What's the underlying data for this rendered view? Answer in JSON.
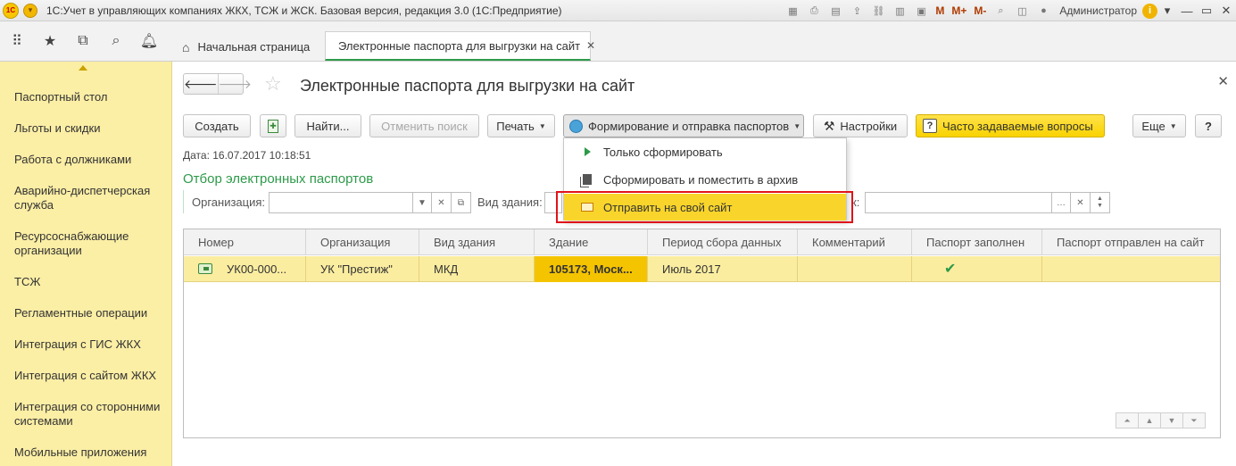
{
  "window": {
    "title": "1С:Учет в управляющих компаниях ЖКХ, ТСЖ и ЖСК. Базовая версия, редакция 3.0  (1С:Предприятие)",
    "user": "Администратор",
    "logo_text": "1С"
  },
  "tabs": [
    {
      "label": "Начальная страница"
    },
    {
      "label": "Электронные паспорта для выгрузки на сайт"
    }
  ],
  "sidebar": {
    "items": [
      {
        "label": "Паспортный стол"
      },
      {
        "label": "Льготы и скидки"
      },
      {
        "label": "Работа с должниками"
      },
      {
        "label": "Аварийно-диспетчерская служба"
      },
      {
        "label": "Ресурсоснабжающие организации"
      },
      {
        "label": "ТСЖ"
      },
      {
        "label": "Регламентные операции"
      },
      {
        "label": "Интеграция с ГИС ЖКХ"
      },
      {
        "label": "Интеграция с сайтом ЖКХ"
      },
      {
        "label": "Интеграция со сторонними системами"
      },
      {
        "label": "Мобильные приложения"
      }
    ]
  },
  "page": {
    "title": "Электронные паспорта для выгрузки на сайт"
  },
  "toolbar": {
    "create": "Создать",
    "find": "Найти...",
    "cancel_search": "Отменить поиск",
    "print": "Печать",
    "form_send": "Формирование и отправка паспортов",
    "settings": "Настройки",
    "faq": "Часто задаваемые вопросы",
    "more": "Еще",
    "help": "?"
  },
  "info": {
    "date_line": "Дата: 16.07.2017 10:18:51"
  },
  "filter": {
    "title": "Отбор электронных паспортов",
    "org_label": "Организация:",
    "building_type_label": "Вид здания:",
    "hidden_label_tail": "к:"
  },
  "menu": {
    "items": [
      {
        "label": "Только сформировать"
      },
      {
        "label": "Сформировать и поместить в архив"
      },
      {
        "label": "Отправить на свой сайт"
      }
    ]
  },
  "table": {
    "columns": [
      "Номер",
      "Организация",
      "Вид здания",
      "Здание",
      "Период сбора данных",
      "Комментарий",
      "Паспорт заполнен",
      "Паспорт отправлен на сайт"
    ],
    "rows": [
      {
        "number": "УК00-000...",
        "org": "УК \"Престиж\"",
        "building_type": "МКД",
        "building": "105173, Моск...",
        "period": "Июль 2017",
        "comment": "",
        "filled": "✔",
        "sent": ""
      }
    ]
  },
  "colors": {
    "sidebar_bg": "#fbeea5",
    "accent_green": "#2d9a4a",
    "highlight_yellow": "#f9d52b",
    "annotation_red": "#e0131a"
  }
}
